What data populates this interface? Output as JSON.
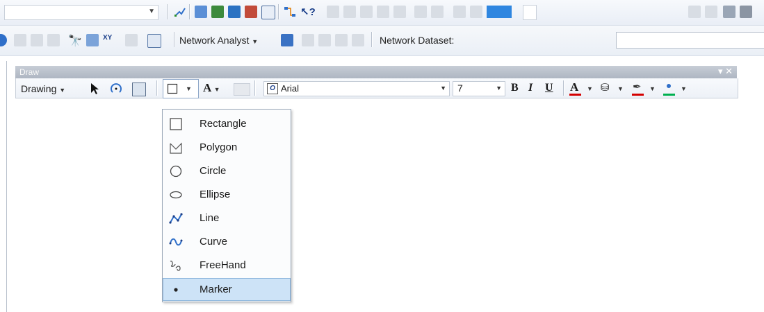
{
  "toolbar_top": {
    "combo_value": "",
    "icons": [
      "edit-vertex-icon",
      "table-icon",
      "layer-icon",
      "catalog-icon",
      "arcmap-icon",
      "python-icon",
      "graph-icon",
      "whats-this-icon"
    ]
  },
  "toolbar_na": {
    "label": "Network Analyst",
    "dataset_label": "Network Dataset:",
    "dataset_value": ""
  },
  "draw_toolbar": {
    "title": "Draw",
    "drawing_menu": "Drawing",
    "font_name": "Arial",
    "font_size": "7",
    "bold": "B",
    "italic": "I",
    "underline": "U",
    "font_color_letter": "A",
    "text_tool_letter": "A"
  },
  "shape_menu": {
    "items": [
      {
        "label": "Rectangle",
        "icon": "rectangle-icon"
      },
      {
        "label": "Polygon",
        "icon": "polygon-icon"
      },
      {
        "label": "Circle",
        "icon": "circle-icon"
      },
      {
        "label": "Ellipse",
        "icon": "ellipse-icon"
      },
      {
        "label": "Line",
        "icon": "line-icon"
      },
      {
        "label": "Curve",
        "icon": "curve-icon"
      },
      {
        "label": "FreeHand",
        "icon": "freehand-icon"
      },
      {
        "label": "Marker",
        "icon": "marker-icon"
      }
    ],
    "selected": "Marker"
  },
  "colors": {
    "accent_blue": "#2f6fc9",
    "selection": "#cde3f7",
    "font_color_bar": "#d40000",
    "marker_color_bar": "#00b050"
  }
}
